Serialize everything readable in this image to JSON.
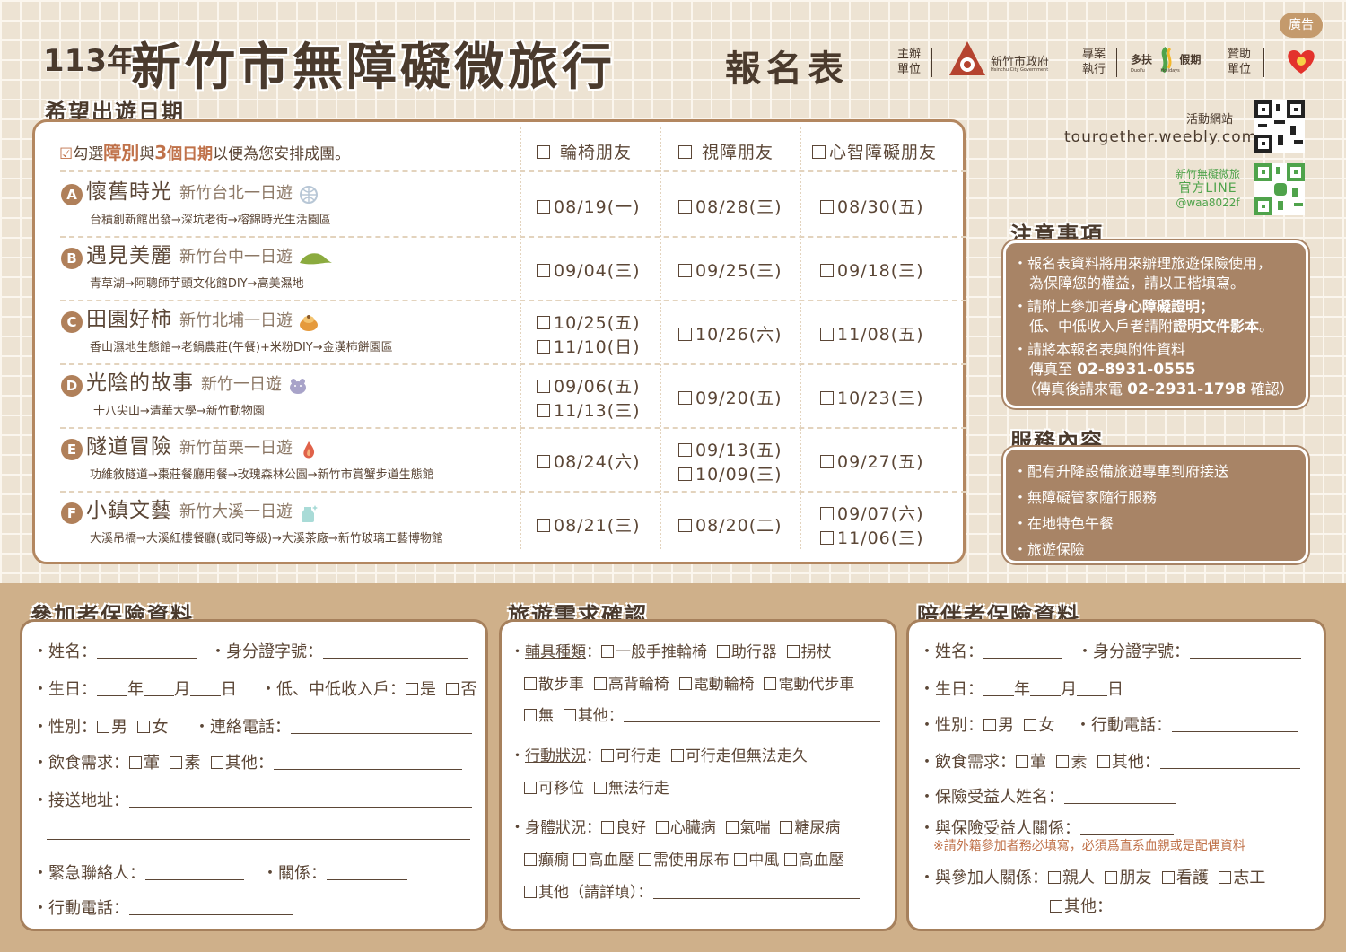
{
  "header": {
    "year": "113年",
    "title": "新竹市無障礙微旅行",
    "subtitle": "報名表",
    "ad": "廣告",
    "organizer_label": "主辦\n單位",
    "organizer_name": "新竹市政府",
    "organizer_en": "Hsinchu City Government",
    "executor_label": "專案\n執行",
    "executor_name": "多扶",
    "executor_name2": "假期",
    "executor_en": "DuoFu",
    "executor_en2": "Holidays",
    "sponsor_label": "贊助\n單位"
  },
  "dates_section": {
    "heading": "希望出遊日期",
    "note": {
      "check": "☑",
      "p1": "勾選",
      "p2": "障別",
      "p3": "與",
      "p4": "3",
      "p5": "個日期",
      "p6": "以便為您安排成團。"
    },
    "categories": [
      "輪椅朋友",
      "視障朋友",
      "心智障礙朋友"
    ],
    "trips": [
      {
        "letter": "A",
        "name": "懷舊時光",
        "sub": "新竹台北一日遊",
        "icon": "globe-icon",
        "route": "台積創新館出發→深坑老街→榕錦時光生活園區",
        "dates": [
          [
            "08/19(一)"
          ],
          [
            "08/28(三)"
          ],
          [
            "08/30(五)"
          ]
        ]
      },
      {
        "letter": "B",
        "name": "遇見美麗",
        "sub": "新竹台中一日遊",
        "icon": "leaf-icon",
        "route": "青草湖→阿聰師芋頭文化館DIY→高美濕地",
        "dates": [
          [
            "09/04(三)"
          ],
          [
            "09/25(三)"
          ],
          [
            "09/18(三)"
          ]
        ]
      },
      {
        "letter": "C",
        "name": "田園好柿",
        "sub": "新竹北埔一日遊",
        "icon": "persimmon-icon",
        "route": "香山濕地生態館→老鍋農莊(午餐)+米粉DIY→金漢柿餅園區",
        "dates": [
          [
            "10/25(五)",
            "11/10(日)"
          ],
          [
            "10/26(六)"
          ],
          [
            "11/08(五)"
          ]
        ]
      },
      {
        "letter": "D",
        "name": "光陰的故事",
        "sub": "新竹一日遊",
        "icon": "hippo-icon",
        "route": "十八尖山→清華大學→新竹動物園",
        "dates": [
          [
            "09/06(五)",
            "11/13(三)"
          ],
          [
            "09/20(五)"
          ],
          [
            "10/23(三)"
          ]
        ]
      },
      {
        "letter": "E",
        "name": "隧道冒險",
        "sub": "新竹苗栗一日遊",
        "icon": "flame-icon",
        "route": "功維敘隧道→棗莊餐廳用餐→玫瑰森林公園→新竹市賞蟹步道生態館",
        "dates": [
          [
            "08/24(六)"
          ],
          [
            "09/13(五)",
            "10/09(三)"
          ],
          [
            "09/27(五)"
          ]
        ]
      },
      {
        "letter": "F",
        "name": "小鎮文藝",
        "sub": "新竹大溪一日遊",
        "icon": "glass-jar-icon",
        "route": "大溪吊橋→大溪紅樓餐廳(或同等級)→大溪茶廠→新竹玻璃工藝博物館",
        "dates": [
          [
            "08/21(三)"
          ],
          [
            "08/20(二)"
          ],
          [
            "09/07(六)",
            "11/06(三)"
          ]
        ]
      }
    ]
  },
  "site": {
    "label": "活動網站",
    "url": "tourgether.weebly.com",
    "line1": "新竹無礙微旅",
    "line2": "官方LINE",
    "line3": "@waa8022f"
  },
  "notes": {
    "heading": "注意事項",
    "n1a": "・報名表資料將用來辦理旅遊保險使用，",
    "n1b": "為保障您的權益，請以正楷填寫。",
    "n2a": "・請附上參加者",
    "n2b": "身心障礙證明；",
    "n2c": "低、中低收入戶者請附",
    "n2d": "證明文件影本",
    "n2e": "。",
    "n3a": "・請將本報名表與附件資料",
    "n3b": "傳真至",
    "n3c": "02-8931-0555",
    "n3d": "（傳真後請來電",
    "n3e": "02-2931-1798",
    "n3f": "確認）"
  },
  "services": {
    "heading": "服務內容",
    "items": [
      "・配有升降設備旅遊專車到府接送",
      "・無障礙管家隨行服務",
      "・在地特色午餐",
      "・旅遊保險"
    ]
  },
  "participant": {
    "heading": "參加者保險資料",
    "name": "・姓名：",
    "id": "・身分證字號：",
    "birth": "・生日：",
    "year": "年",
    "month": "月",
    "day": "日",
    "low_income": "・低、中低收入戶：",
    "yes": "是",
    "no": "否",
    "gender": "・性別：",
    "male": "男",
    "female": "女",
    "phone": "・連絡電話：",
    "diet": "・飲食需求：",
    "meat": "葷",
    "veg": "素",
    "other": "其他：",
    "address": "・接送地址：",
    "emergency": "・緊急聯絡人：",
    "relation": "・關係：",
    "mobile": "・行動電話："
  },
  "needs": {
    "heading": "旅遊需求確認",
    "aid_label": "輔具種類",
    "aids1": [
      "一般手推輪椅",
      "助行器",
      "拐杖"
    ],
    "aids2": [
      "散步車",
      "高背輪椅",
      "電動輪椅",
      "電動代步車"
    ],
    "aids3_none": "無",
    "aids3_other": "其他：",
    "mob_label": "行動狀況",
    "mob1": [
      "可行走",
      "可行走但無法走久"
    ],
    "mob2": [
      "可移位",
      "無法行走"
    ],
    "health_label": "身體狀況",
    "h1": [
      "良好",
      "心臟病",
      "氣喘",
      "糖尿病"
    ],
    "h2": [
      "癲癇",
      "高血壓",
      "需使用尿布",
      "中風",
      "高血壓"
    ],
    "h3": "其他（請詳填）：",
    "colon": "："
  },
  "companion": {
    "heading": "陪伴者保險資料",
    "name": "・姓名：",
    "id": "・身分證字號：",
    "birth": "・生日：",
    "year": "年",
    "month": "月",
    "day": "日",
    "gender": "・性別：",
    "male": "男",
    "female": "女",
    "phone": "・行動電話：",
    "diet": "・飲食需求：",
    "meat": "葷",
    "veg": "素",
    "other": "其他：",
    "beneficiary": "・保險受益人姓名：",
    "ben_relation": "・與保險受益人關係：",
    "warn": "※請外籍參加者務必填寫，必須爲直系血親或是配偶資料",
    "rel_participant": "・與參加人關係：",
    "rels": [
      "親人",
      "朋友",
      "看護",
      "志工"
    ],
    "rel_other": "其他："
  }
}
